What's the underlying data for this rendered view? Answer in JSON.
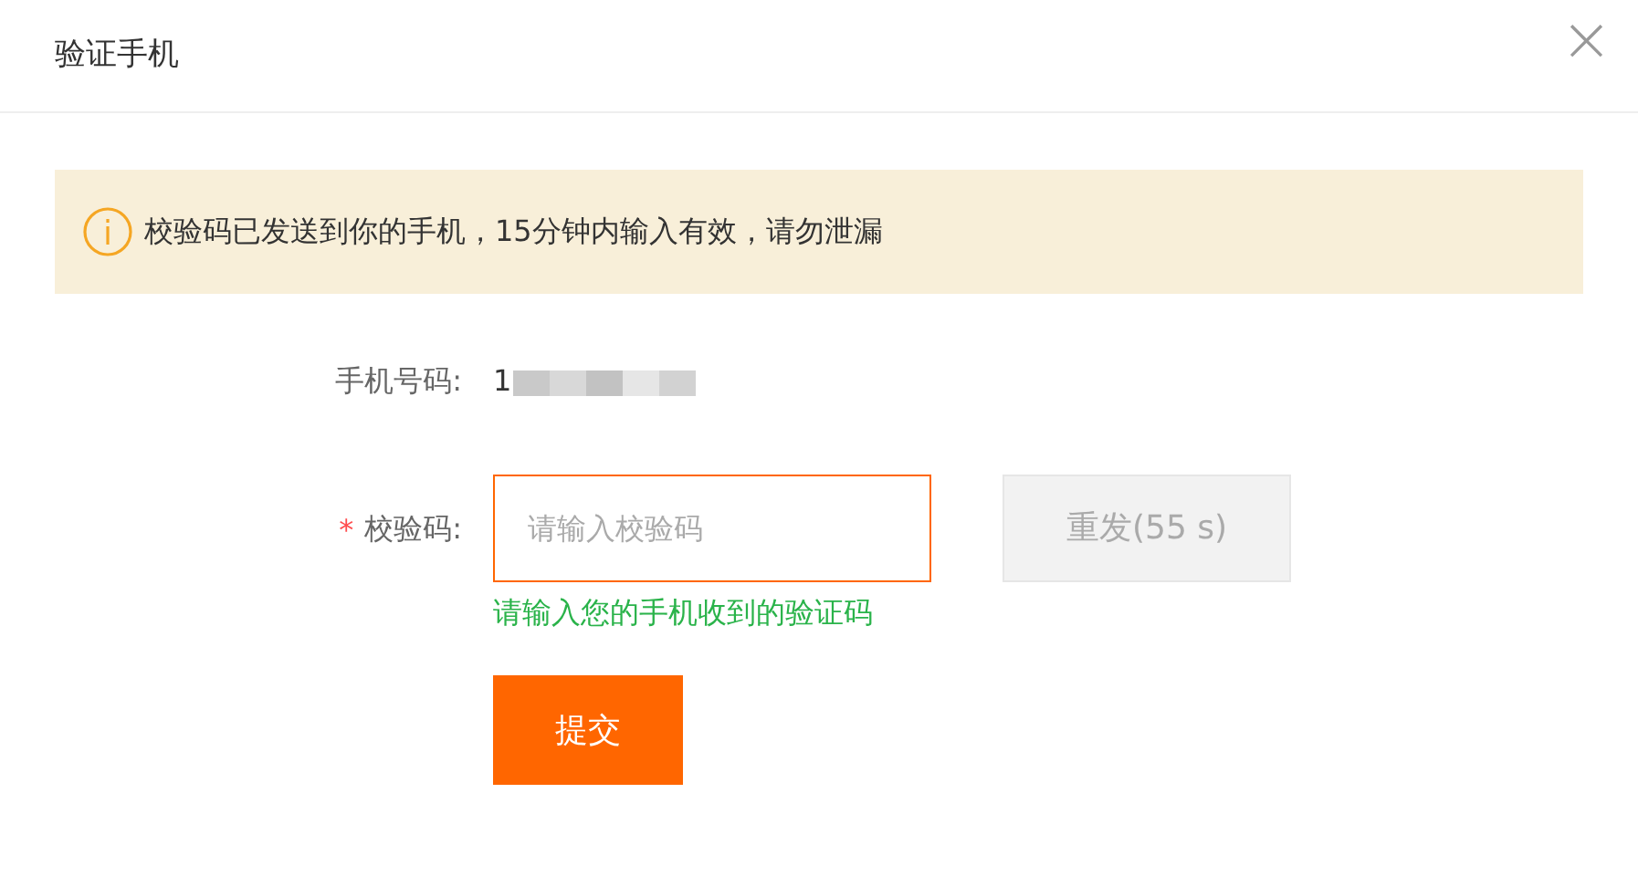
{
  "dialog": {
    "title": "验证手机",
    "close": "×"
  },
  "notice": {
    "text": "校验码已发送到你的手机，15分钟内输入有效，请勿泄漏"
  },
  "phone": {
    "label": "手机号码:",
    "value": "1"
  },
  "code": {
    "required_mark": "*",
    "label": "校验码:",
    "placeholder": "请输入校验码",
    "focused": true,
    "hint": "请输入您的手机收到的验证码"
  },
  "resend": {
    "label": "重发(55 s)",
    "disabled": true
  },
  "submit": {
    "label": "提交"
  }
}
